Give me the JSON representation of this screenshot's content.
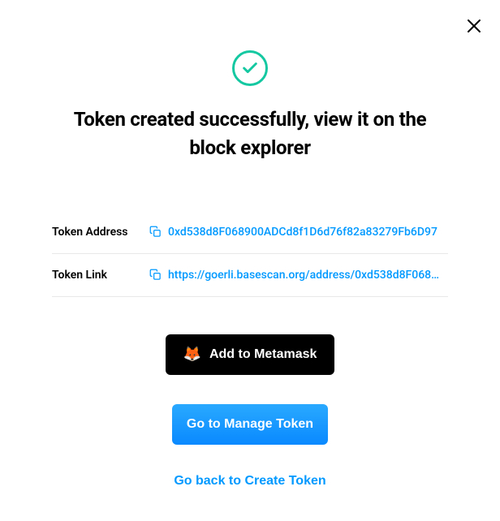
{
  "title": "Token created successfully, view it on the block explorer",
  "fields": {
    "address": {
      "label": "Token Address",
      "value": "0xd538d8F068900ADCd8f1D6d76f82a83279Fb6D97"
    },
    "link": {
      "label": "Token Link",
      "value": "https://goerli.basescan.org/address/0xd538d8F068…"
    }
  },
  "buttons": {
    "add_metamask": "Add to Metamask",
    "manage_token": "Go to Manage Token",
    "go_back": "Go back to Create Token"
  },
  "icons": {
    "fox": "🦊"
  }
}
